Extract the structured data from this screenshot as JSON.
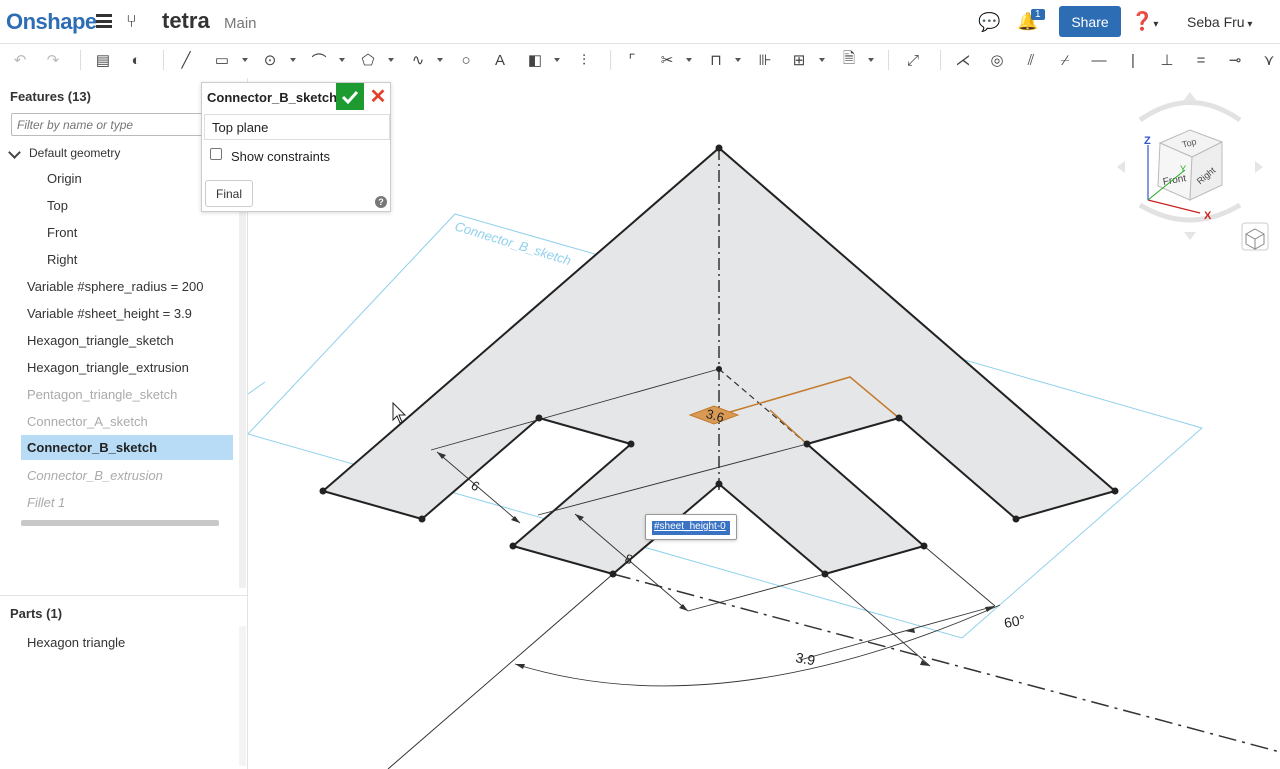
{
  "header": {
    "logo": "Onshape",
    "doc_title": "tetra",
    "workspace": "Main",
    "notification_count": "1",
    "share_label": "Share",
    "user_name": "Seba Fru"
  },
  "toolbar": {
    "icons": [
      "undo-icon",
      "redo-icon",
      "sketch-icon",
      "variable-icon",
      "line-icon",
      "rectangle-icon",
      "circle-icon",
      "arc-icon",
      "polygon-icon",
      "spline-icon",
      "point-icon",
      "text-icon",
      "use-icon",
      "mirror-icon",
      "fillet-icon",
      "trim-icon",
      "extend-icon",
      "offset-icon",
      "pattern-icon",
      "dxf-icon",
      "dimension-icon",
      "coincident-icon",
      "concentric-icon",
      "parallel-icon",
      "tangent-icon",
      "horizontal-icon",
      "vertical-icon",
      "perpendicular-icon",
      "equal-icon",
      "midpoint-icon",
      "normal-icon"
    ]
  },
  "sidebar": {
    "features_title": "Features (13)",
    "filter_placeholder": "Filter by name or type",
    "group_label": "Default geometry",
    "items": [
      {
        "label": "Origin"
      },
      {
        "label": "Top"
      },
      {
        "label": "Front"
      },
      {
        "label": "Right"
      },
      {
        "label": "Variable #sphere_radius = 200"
      },
      {
        "label": "Variable #sheet_height = 3.9"
      },
      {
        "label": "Hexagon_triangle_sketch"
      },
      {
        "label": "Hexagon_triangle_extrusion"
      },
      {
        "label": "Pentagon_triangle_sketch"
      },
      {
        "label": "Connector_A_sketch"
      },
      {
        "label": "Connector_B_sketch"
      },
      {
        "label": "Connector_B_extrusion"
      },
      {
        "label": "Fillet 1"
      }
    ],
    "parts_title": "Parts (1)",
    "parts": [
      {
        "label": "Hexagon triangle"
      }
    ]
  },
  "sketch_dialog": {
    "title": "Connector_B_sketch",
    "plane": "Top plane",
    "show_constraints_label": "Show constraints",
    "show_constraints_checked": false,
    "final_label": "Final",
    "help_glyph": "?"
  },
  "viewport": {
    "plane_label": "Connector_B_sketch",
    "dim_angle": "60°",
    "dim_height": "3.9",
    "dim_left": "6",
    "dim_mid": "8",
    "dim_highlight": "3.6",
    "edit_value": "#sheet_height-0",
    "view_cube": {
      "top": "Top",
      "front": "Front",
      "right": "Right",
      "axis_z": "Z",
      "axis_x": "X",
      "axis_y": "Y"
    }
  },
  "colors": {
    "brand": "#2d6db4",
    "accept": "#1d9a30",
    "cancel": "#e2402a",
    "selection": "#b8dcf5",
    "sketch_fill": "#e4e6e8",
    "highlight_dim": "#c47a2b",
    "plane_outline": "#8fd0ec"
  }
}
